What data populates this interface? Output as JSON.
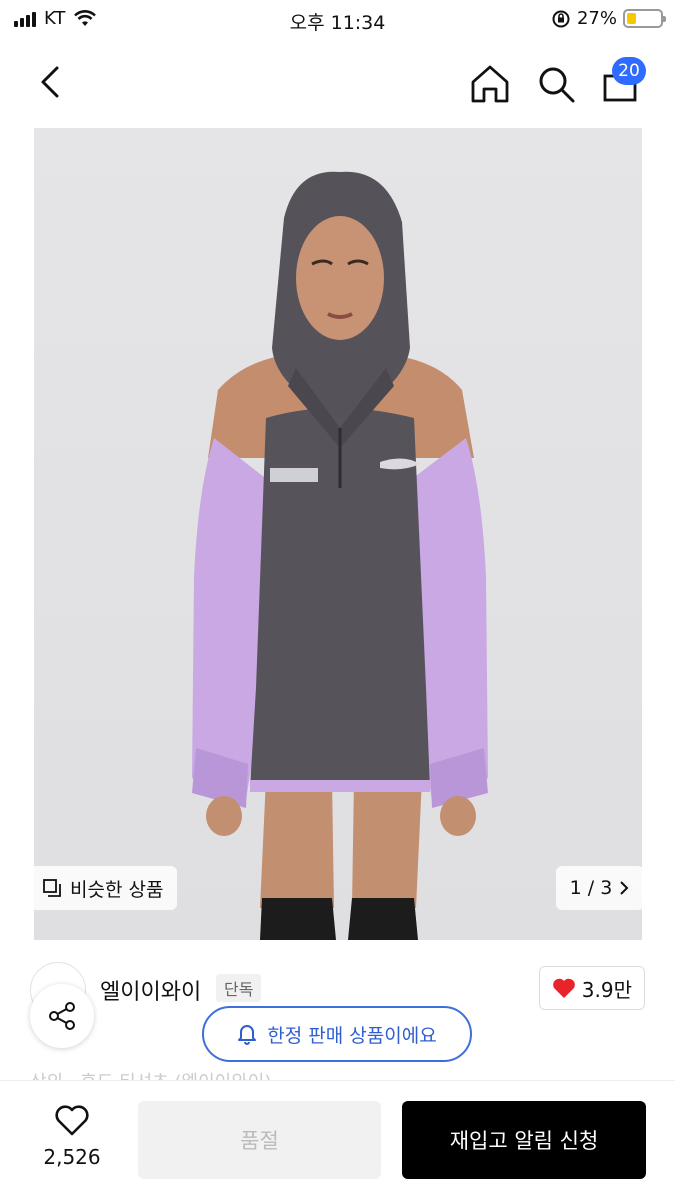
{
  "status_bar": {
    "carrier": "KT",
    "time": "오후 11:34",
    "battery_percent": "27%",
    "battery_level": 0.27
  },
  "nav": {
    "cart_count": "20"
  },
  "gallery": {
    "similar_label": "비슷한 상품",
    "pager": "1 / 3",
    "description": "Model wearing a charcoal hooded half-zip pullover with lavender sleeves and cold-shoulder cutouts"
  },
  "brand": {
    "name": "엘이이와이",
    "tag": "단독"
  },
  "likes": {
    "count": "3.9만"
  },
  "limited_banner": {
    "label": "한정 판매 상품이에요"
  },
  "faded_text": "상의 · 후드 티셔츠 (엘이이와이)",
  "bottom_bar": {
    "wish_count": "2,526",
    "soldout_label": "품절",
    "restock_label": "재입고 알림 신청"
  },
  "colors": {
    "accent_blue": "#2f6bff",
    "heart_red": "#e8232a",
    "hoodie_charcoal": "#57535b",
    "sleeve_lavender": "#c9a8e4"
  }
}
